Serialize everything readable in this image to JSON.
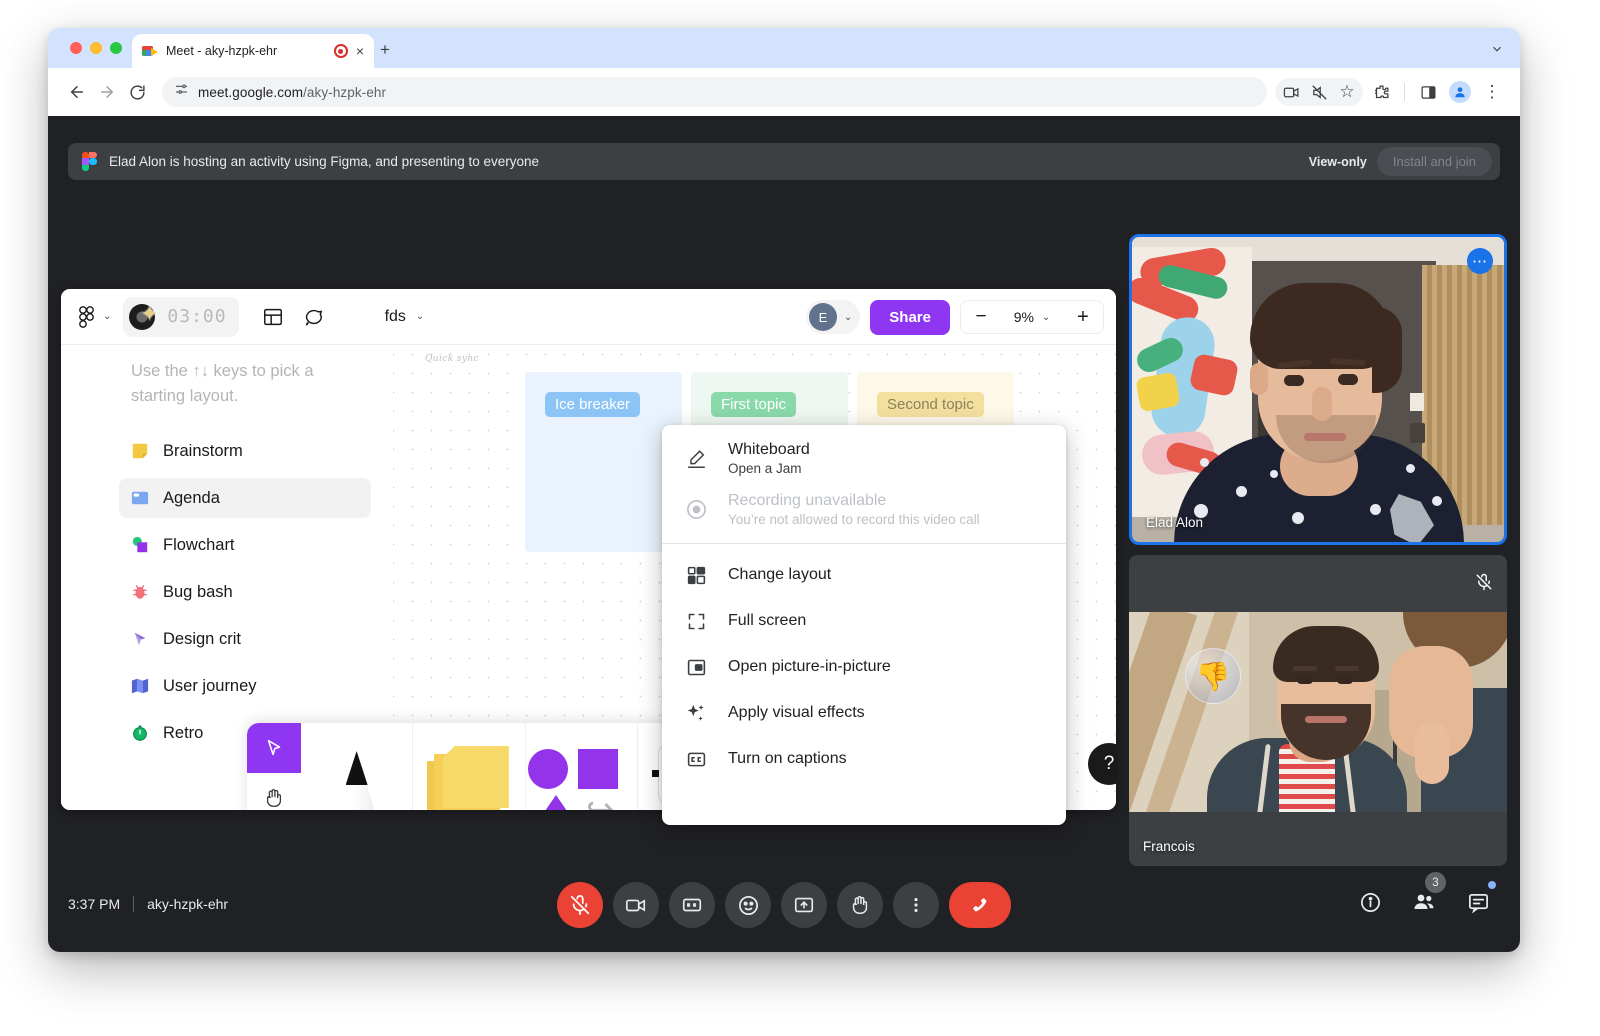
{
  "browser": {
    "tab": {
      "title": "Meet - aky-hzpk-ehr",
      "favicon": "google-meet-icon",
      "recording_indicator": "record-dot-icon",
      "close": "×"
    },
    "new_tab": "+",
    "window_chevron": "⌄",
    "nav": {
      "back": "←",
      "forward": "→",
      "reload": "⟳"
    },
    "omnibox": {
      "icon": "site-settings-icon",
      "url_domain": "meet.google.com",
      "url_path": "/aky-hzpk-ehr"
    },
    "actions": {
      "media_cast": "cast-video-icon",
      "mute_site": "muted-speaker-icon",
      "bookmark": "☆",
      "extensions": "extensions-puzzle-icon",
      "side_panel": "side-panel-icon",
      "profile": "profile-avatar-icon",
      "more": "⋮"
    }
  },
  "banner": {
    "app_icon": "figma-icon",
    "message": "Elad Alon is hosting an activity using Figma, and presenting to everyone",
    "view_only_label": "View-only",
    "install_button": "Install and join"
  },
  "figma": {
    "logo": "figma-logo-icon",
    "logo_chevron": "⌄",
    "timer": {
      "value": "03:00",
      "badge_icon": "music-star-badge-icon"
    },
    "layout_icon": "panel-layout-icon",
    "comment_icon": "comment-bubble-icon",
    "filename": "fds",
    "filename_chevron": "⌄",
    "avatar_initial": "E",
    "avatar_chevron": "⌄",
    "share_label": "Share",
    "zoom": {
      "minus": "−",
      "value": "9%",
      "chevron": "⌄",
      "plus": "+"
    },
    "hint": "Use the ↑↓ keys to pick a starting layout.",
    "templates": [
      {
        "label": "Brainstorm",
        "icon": "sticky-note-icon",
        "selected": false
      },
      {
        "label": "Agenda",
        "icon": "agenda-board-icon",
        "selected": true
      },
      {
        "label": "Flowchart",
        "icon": "flowchart-icon",
        "selected": false
      },
      {
        "label": "Bug bash",
        "icon": "bug-icon",
        "selected": false
      },
      {
        "label": "Design crit",
        "icon": "cursor-pen-icon",
        "selected": false
      },
      {
        "label": "User journey",
        "icon": "map-icon",
        "selected": false
      },
      {
        "label": "Retro",
        "icon": "stopwatch-icon",
        "selected": false
      }
    ],
    "board": {
      "title": "Quick sync",
      "columns": [
        {
          "label": "Ice breaker"
        },
        {
          "label": "First topic"
        },
        {
          "label": "Second topic"
        }
      ]
    },
    "tray": {
      "cursor_icon": "cursor-arrow-icon",
      "hand_icon": "hand-pan-icon",
      "pen_icon": "marker-pen-icon",
      "sticky_icon": "sticky-notes-icon",
      "shapes_icon": "shapes-icon",
      "text_icon": "text-tool-icon"
    },
    "help_button": "?"
  },
  "context_menu": {
    "items": [
      {
        "title": "Whiteboard",
        "subtitle": "Open a Jam",
        "icon": "pencil-underline-icon",
        "disabled": false
      },
      {
        "title": "Recording unavailable",
        "subtitle": "You’re not allowed to record this video call",
        "icon": "record-circle-icon",
        "disabled": true
      },
      {
        "title": "Change layout",
        "subtitle": "",
        "icon": "layout-grid-icon",
        "disabled": false
      },
      {
        "title": "Full screen",
        "subtitle": "",
        "icon": "fullscreen-icon",
        "disabled": false
      },
      {
        "title": "Open picture-in-picture",
        "subtitle": "",
        "icon": "pip-icon",
        "disabled": false
      },
      {
        "title": "Apply visual effects",
        "subtitle": "",
        "icon": "sparkles-icon",
        "disabled": false
      },
      {
        "title": "Turn on captions",
        "subtitle": "",
        "icon": "closed-caption-icon",
        "disabled": false
      }
    ]
  },
  "participants": [
    {
      "name": "Elad Alon",
      "speaking": true,
      "more_icon": "more-options-icon",
      "muted": false
    },
    {
      "name": "Francois",
      "speaking": false,
      "muted": true,
      "mute_icon": "mic-off-icon",
      "reaction": "👎"
    }
  ],
  "bottom_bar": {
    "time": "3:37 PM",
    "meeting_code": "aky-hzpk-ehr",
    "controls": [
      {
        "name": "microphone-off-button",
        "icon": "mic-off-icon",
        "state": "muted"
      },
      {
        "name": "camera-button",
        "icon": "video-camera-icon",
        "state": "on"
      },
      {
        "name": "captions-button",
        "icon": "closed-caption-icon",
        "state": "off"
      },
      {
        "name": "reactions-button",
        "icon": "emoji-smiley-icon",
        "state": "off"
      },
      {
        "name": "present-now-button",
        "icon": "present-screen-icon",
        "state": "off"
      },
      {
        "name": "raise-hand-button",
        "icon": "raised-hand-icon",
        "state": "off"
      },
      {
        "name": "more-options-button",
        "icon": "vertical-dots-icon",
        "state": "off"
      },
      {
        "name": "leave-call-button",
        "icon": "end-call-icon",
        "state": "danger"
      }
    ],
    "right": {
      "meeting_details": "info-icon",
      "people": {
        "icon": "people-icon",
        "count": "3"
      },
      "chat": {
        "icon": "chat-icon",
        "unread": true
      }
    }
  },
  "colors": {
    "meet_bg": "#202124",
    "banner_bg": "#3c4043",
    "accent_blue": "#1a73e8",
    "danger_red": "#ea4335",
    "figma_purple": "#8f36f2"
  }
}
